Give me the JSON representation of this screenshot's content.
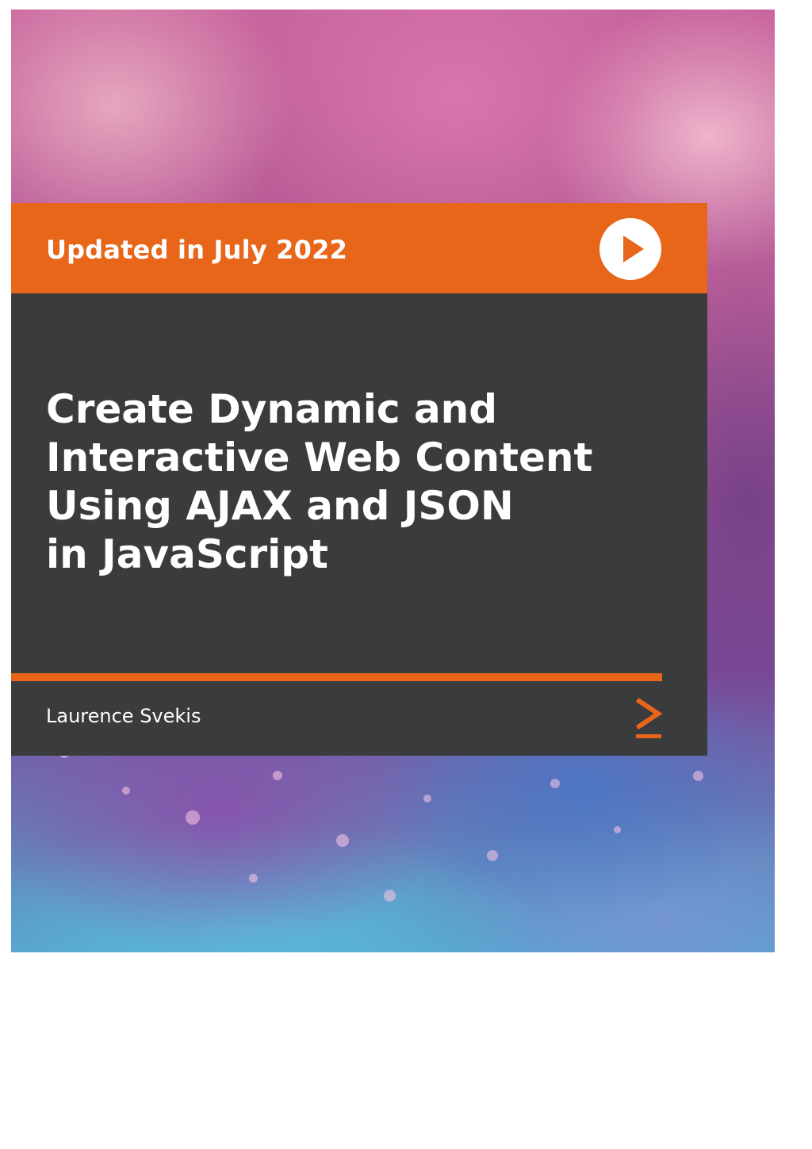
{
  "cover": {
    "badge_text": "Updated in July 2022",
    "title": "Create Dynamic and\nInteractive Web Content\nUsing AJAX and JSON\nin JavaScript",
    "author": "Laurence Svekis",
    "icons": {
      "play": "play-button-icon",
      "logo": "chevron-logo-icon"
    },
    "colors": {
      "accent": "#e8661a",
      "panel": "#3a3b3d",
      "text": "#ffffff"
    }
  }
}
